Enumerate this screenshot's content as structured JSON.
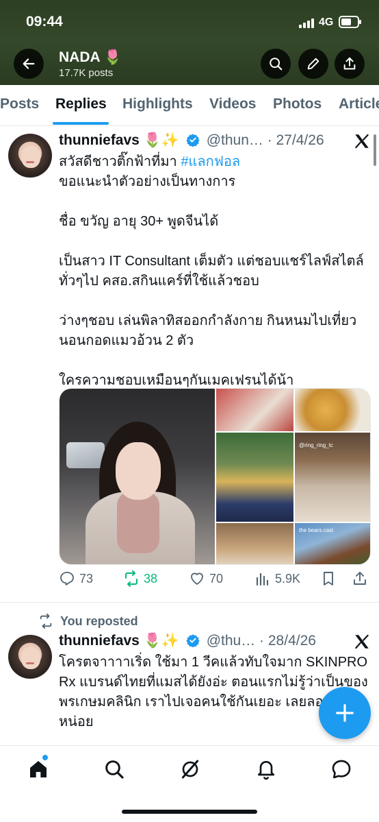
{
  "status_bar": {
    "time": "09:44",
    "network": "4G"
  },
  "header": {
    "name": "NADA",
    "name_emoji": "🌷",
    "posts_count": "17.7K posts"
  },
  "tabs": [
    {
      "label": "Posts"
    },
    {
      "label": "Replies"
    },
    {
      "label": "Highlights"
    },
    {
      "label": "Videos"
    },
    {
      "label": "Photos"
    },
    {
      "label": "Articles"
    }
  ],
  "active_tab": "Replies",
  "tweets": [
    {
      "name": "thunniefavs",
      "name_emoji": "🌷✨",
      "handle": "@thun…",
      "date": "· 27/4/26",
      "lines": [
        {
          "text": "สวัสดีชาวติ๊กฟ้าที่มา ",
          "tag": "#แลกฟอล"
        },
        {
          "text": "ขอแนะนำตัวอย่างเป็นทางการ"
        },
        {
          "text": ""
        },
        {
          "text": "ชื่อ ขวัญ อายุ 30+ พูดจีนได้"
        },
        {
          "text": ""
        },
        {
          "text": "เป็นสาว IT Consultant เต็มตัว แต่ชอบแชร์ไลฟ์สไตล์"
        },
        {
          "text": "ทั่วๆไป คสอ.สกินแคร์ที่ใช้แล้วชอบ"
        },
        {
          "text": ""
        },
        {
          "text": "ว่างๆชอบ เล่นพิลาทิสออกกำลังกาย กินหนมไปเที่ยว"
        },
        {
          "text": "นอนกอดแมวอ้วน 2 ตัว"
        },
        {
          "text": ""
        },
        {
          "text": "ใครความชอบเหมือนๆกันเมคเฟรนได้น้า"
        }
      ],
      "media_captions": [
        "@ring_ring_tc",
        "the bears.cast"
      ],
      "stats": {
        "replies": "73",
        "reposts": "38",
        "likes": "70",
        "views": "5.9K"
      }
    },
    {
      "repost_label": "You reposted",
      "name": "thunniefavs",
      "name_emoji": "🌷✨",
      "handle": "@thu…",
      "date": "· 28/4/26",
      "lines": [
        {
          "text": "โครตจาาาาเริ่ด ใช้มา 1 วีคแล้วทับใจมาก SKINPRO"
        },
        {
          "text": "Rx แบรนด์ไทยที่แมสได้ยังอ่ะ ตอนแรกไม่รู้ว่าเป็นของ"
        },
        {
          "text": "พรเกษมคลินิก เราไปเจอคนใช้กันเยอะ เลยลอง"
        },
        {
          "text": "หน่อย"
        }
      ]
    }
  ],
  "icons": {
    "back": "arrow-left-icon",
    "search": "search-icon",
    "edit": "pen-icon",
    "share": "share-icon",
    "verified": "verified-badge-icon",
    "x_logo": "x-logo-icon",
    "nav": [
      "home-icon",
      "search-icon",
      "grok-icon",
      "bell-icon",
      "messages-icon"
    ],
    "compose": "plus-icon"
  },
  "colors": {
    "accent": "#1d9bf0",
    "repost_active": "#00ba7c",
    "header_bg": "#2f4326"
  }
}
